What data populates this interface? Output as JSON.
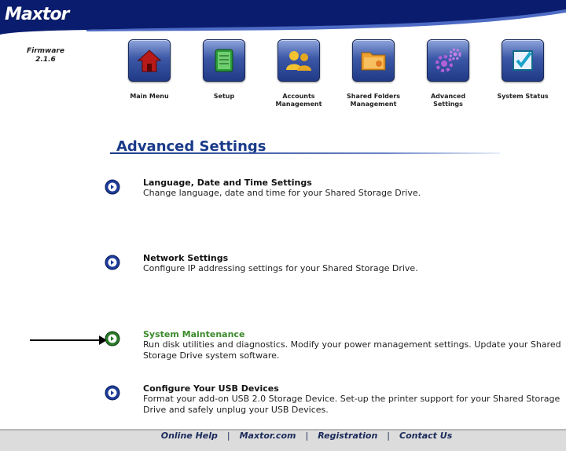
{
  "brand": {
    "logo": "Maxtor",
    "firmware_label": "Firmware",
    "firmware_version": "2.1.6"
  },
  "nav": [
    {
      "label": "Main Menu",
      "icon": "home-icon"
    },
    {
      "label": "Setup",
      "icon": "setup-book-icon"
    },
    {
      "label": "Accounts Management",
      "icon": "users-icon"
    },
    {
      "label": "Shared Folders Management",
      "icon": "folders-icon"
    },
    {
      "label": "Advanced Settings",
      "icon": "gears-icon"
    },
    {
      "label": "System Status",
      "icon": "checkbox-icon"
    }
  ],
  "page": {
    "title": "Advanced Settings"
  },
  "items": [
    {
      "title": "Language, Date and Time Settings",
      "desc": "Change language, date and time for your Shared Storage Drive."
    },
    {
      "title": "Network Settings",
      "desc": "Configure IP addressing settings for your Shared Storage Drive."
    },
    {
      "title": "System Maintenance",
      "desc": "Run disk utilities and diagnostics. Modify your power management settings. Update your Shared Storage Drive system software."
    },
    {
      "title": "Configure Your USB Devices",
      "desc": "Format your add-on USB 2.0 Storage Device. Set-up the printer support for your Shared Storage Drive and safely unplug your USB Devices."
    }
  ],
  "footer": {
    "help": "Online Help",
    "site": "Maxtor.com",
    "registration": "Registration",
    "contact": "Contact Us",
    "separator": "|"
  },
  "colors": {
    "accent": "#1a3a8a",
    "active_item": "#3a8a2a",
    "header_blue": "#0a1c6e"
  }
}
